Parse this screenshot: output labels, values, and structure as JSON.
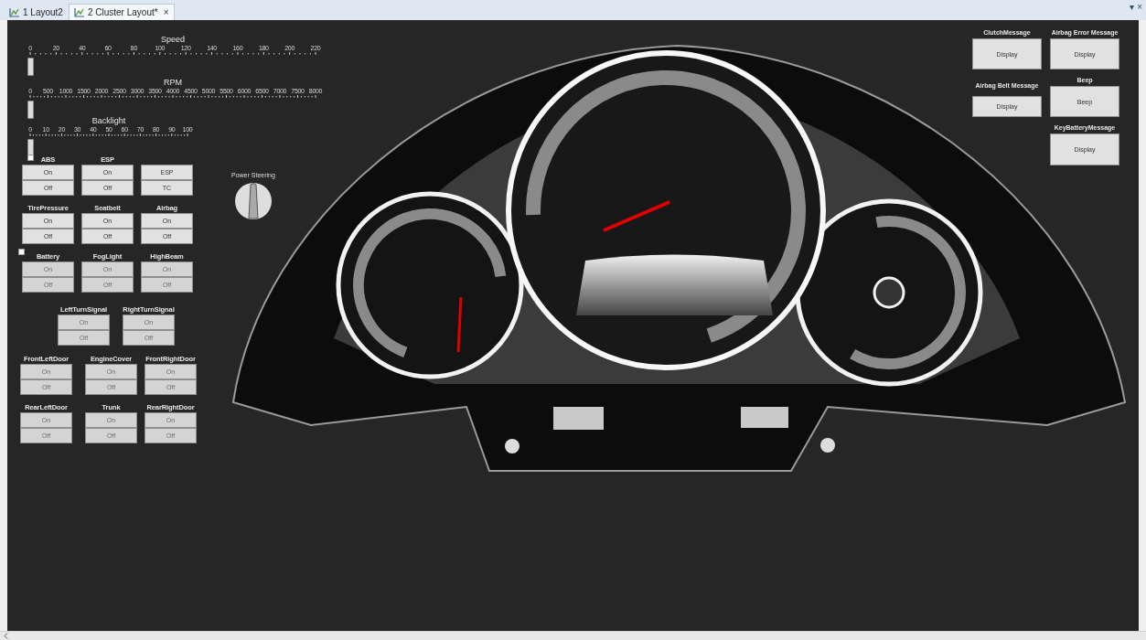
{
  "tabs": [
    {
      "label": "1 Layout2",
      "selected": false
    },
    {
      "label": "2 Cluster Layout*",
      "selected": true,
      "close": "×"
    }
  ],
  "window_controls": [
    "▾",
    "×"
  ],
  "sliders": [
    {
      "label": "Speed",
      "ticks": [
        "0",
        "20",
        "40",
        "60",
        "80",
        "100",
        "120",
        "140",
        "160",
        "180",
        "200",
        "220"
      ],
      "level": 0
    },
    {
      "label": "RPM",
      "ticks": [
        "0",
        "500",
        "1000",
        "1500",
        "2000",
        "2500",
        "3000",
        "3500",
        "4000",
        "4500",
        "5000",
        "5500",
        "6000",
        "6500",
        "7000",
        "7500",
        "8000"
      ],
      "level": 0
    },
    {
      "label": "Backlight",
      "ticks": [
        "0",
        "10",
        "20",
        "30",
        "40",
        "50",
        "60",
        "70",
        "80",
        "90",
        "100"
      ],
      "level": 0
    }
  ],
  "checkboxes": [
    {
      "checked": false
    },
    {
      "checked": false
    }
  ],
  "toggle_groups": [
    {
      "title": "ABS",
      "buttons": [
        {
          "label": "On",
          "disabled": false
        },
        {
          "label": "Off",
          "disabled": false
        }
      ]
    },
    {
      "title": "ESP",
      "buttons": [
        {
          "label": "On",
          "disabled": false
        },
        {
          "label": "Off",
          "disabled": false
        }
      ]
    },
    {
      "buttons": [
        {
          "label": "ESP",
          "disabled": false
        },
        {
          "label": "TC",
          "disabled": false
        }
      ]
    },
    {
      "title": "TirePressure",
      "buttons": [
        {
          "label": "On",
          "disabled": false
        },
        {
          "label": "Off",
          "disabled": false
        }
      ]
    },
    {
      "title": "Seatbelt",
      "buttons": [
        {
          "label": "On",
          "disabled": false
        },
        {
          "label": "Off",
          "disabled": false
        }
      ]
    },
    {
      "title": "Airbag",
      "buttons": [
        {
          "label": "On",
          "disabled": false
        },
        {
          "label": "Off",
          "disabled": false
        }
      ]
    },
    {
      "title": "Battery",
      "buttons": [
        {
          "label": "On",
          "disabled": true
        },
        {
          "label": "Off",
          "disabled": true
        }
      ]
    },
    {
      "title": "FogLight",
      "buttons": [
        {
          "label": "On",
          "disabled": true
        },
        {
          "label": "Off",
          "disabled": true
        }
      ]
    },
    {
      "title": "HighBeam",
      "buttons": [
        {
          "label": "On",
          "disabled": true
        },
        {
          "label": "Off",
          "disabled": true
        }
      ]
    },
    {
      "title": "LeftTurnSignal",
      "buttons": [
        {
          "label": "On",
          "disabled": true
        },
        {
          "label": "Off",
          "disabled": true
        }
      ]
    },
    {
      "title": "RightTurnSignal",
      "buttons": [
        {
          "label": "On",
          "disabled": true
        },
        {
          "label": "Off",
          "disabled": true
        }
      ]
    },
    {
      "title": "FrontLeftDoor",
      "buttons": [
        {
          "label": "On",
          "disabled": true
        },
        {
          "label": "Off",
          "disabled": true
        }
      ]
    },
    {
      "title": "EngineCover",
      "buttons": [
        {
          "label": "On",
          "disabled": true
        },
        {
          "label": "Off",
          "disabled": true
        }
      ]
    },
    {
      "title": "FrontRightDoor",
      "buttons": [
        {
          "label": "On",
          "disabled": true
        },
        {
          "label": "Off",
          "disabled": true
        }
      ]
    },
    {
      "title": "RearLeftDoor",
      "buttons": [
        {
          "label": "On",
          "disabled": true
        },
        {
          "label": "Off",
          "disabled": true
        }
      ]
    },
    {
      "title": "Trunk",
      "buttons": [
        {
          "label": "On",
          "disabled": true
        },
        {
          "label": "Off",
          "disabled": true
        }
      ]
    },
    {
      "title": "RearRightDoor",
      "buttons": [
        {
          "label": "On",
          "disabled": true
        },
        {
          "label": "Off",
          "disabled": true
        }
      ]
    }
  ],
  "knob": {
    "label": "Power Steering"
  },
  "cluster": {
    "kind": "picture"
  },
  "message_groups": [
    {
      "title": "ClutchMessage",
      "button": "Display"
    },
    {
      "title": "Airbag Belt Message",
      "button": "Display"
    },
    {
      "title": "Airbag Error Message",
      "button": "Display"
    },
    {
      "title": "Beep",
      "button": "Beep"
    },
    {
      "title": "KeyBatteryMessage",
      "button": "Display"
    }
  ]
}
